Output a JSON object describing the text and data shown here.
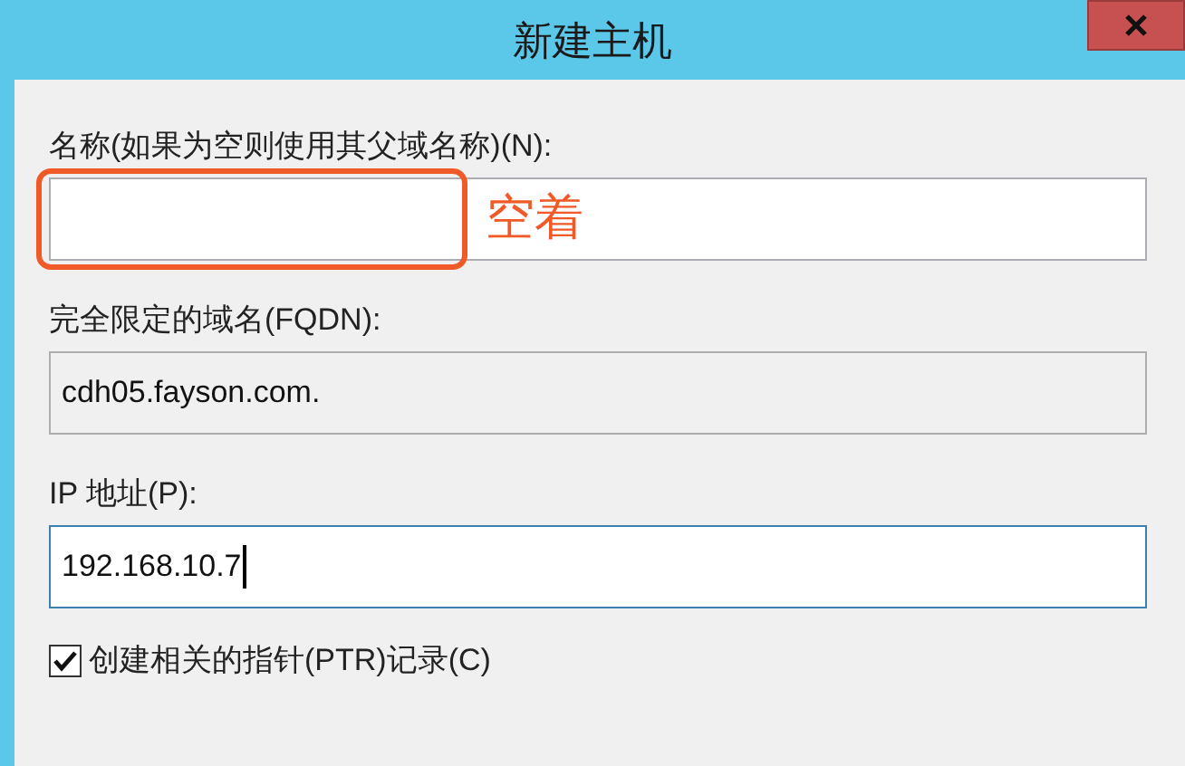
{
  "window": {
    "title": "新建主机"
  },
  "fields": [
    {
      "label": "名称(如果为空则使用其父域名称)(N):",
      "readonly": false,
      "focused": false,
      "annotation": "空着"
    },
    {
      "label": "完全限定的域名(FQDN):",
      "value": "cdh05.fayson.com.",
      "readonly": true,
      "focused": false
    },
    {
      "label": "IP 地址(P):",
      "value": "192.168.10.7",
      "readonly": false,
      "focused": true
    }
  ],
  "checkbox": {
    "label": "创建相关的指针(PTR)记录(C)",
    "checked": true
  }
}
